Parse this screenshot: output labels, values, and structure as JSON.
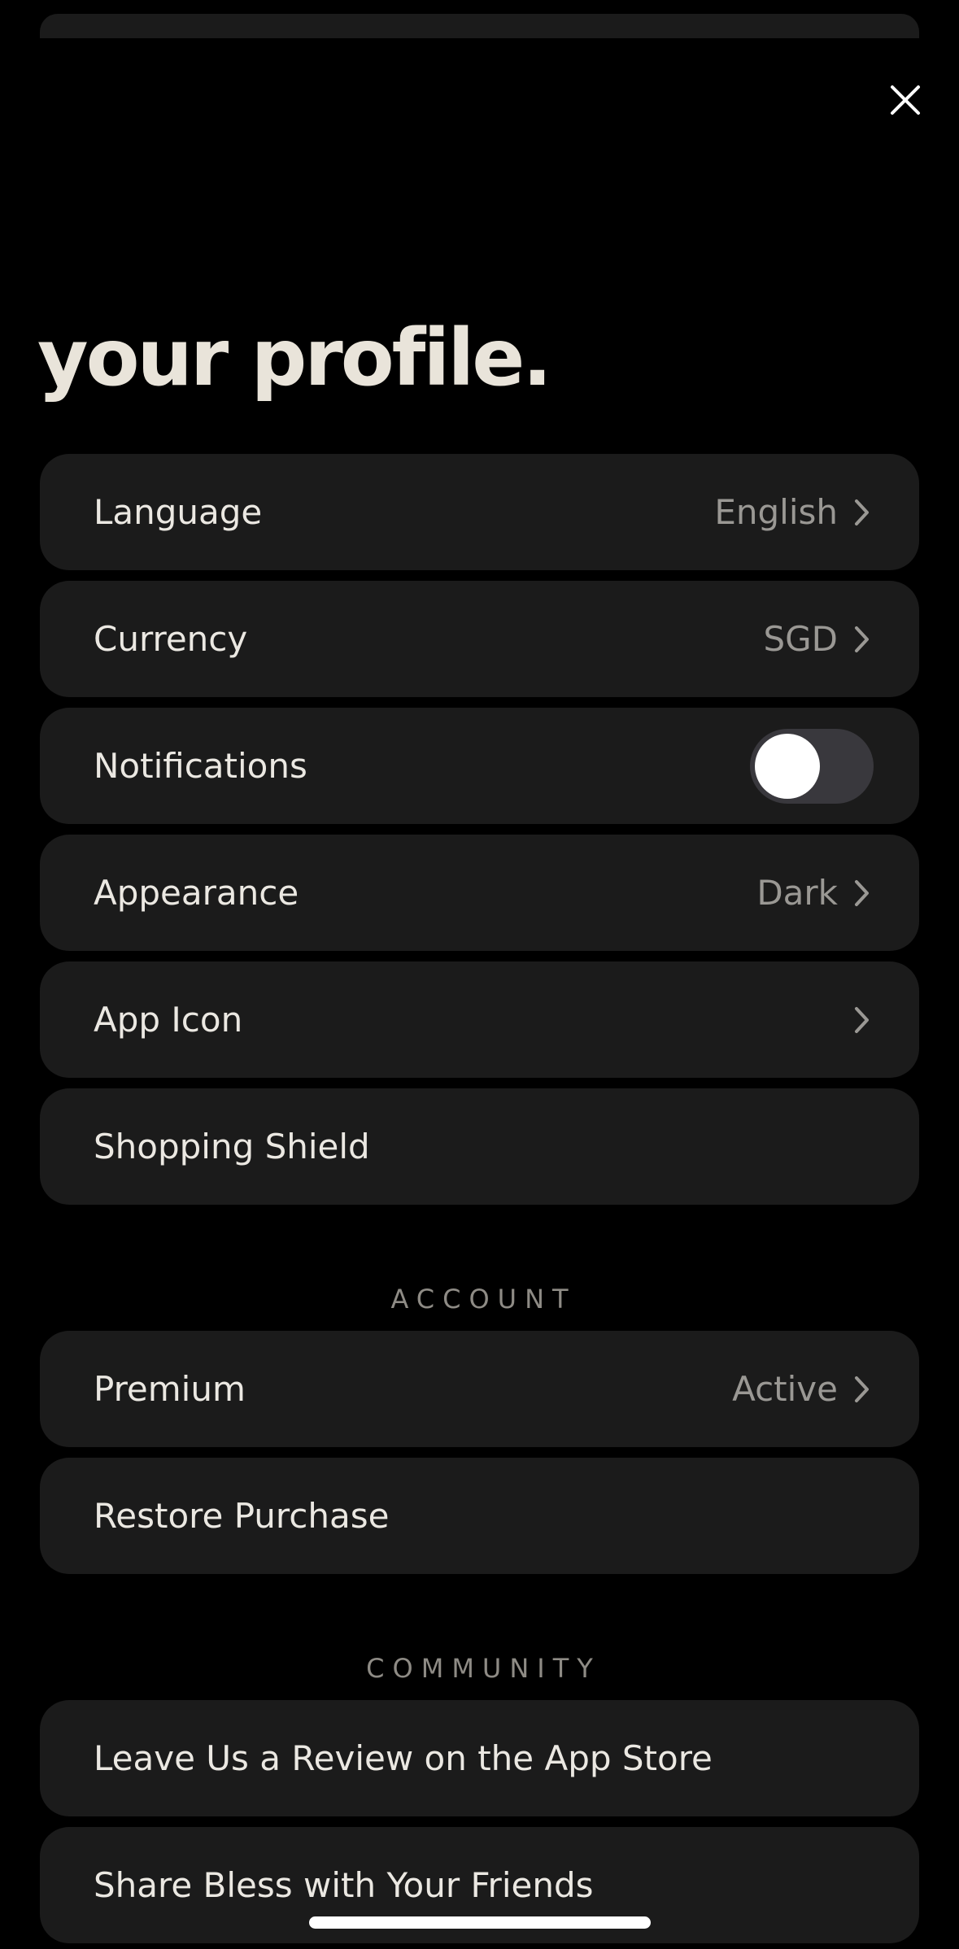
{
  "header": {
    "title": "your profile."
  },
  "settings": {
    "language": {
      "label": "Language",
      "value": "English"
    },
    "currency": {
      "label": "Currency",
      "value": "SGD"
    },
    "notifications": {
      "label": "Notifications",
      "enabled": true
    },
    "appearance": {
      "label": "Appearance",
      "value": "Dark"
    },
    "app_icon": {
      "label": "App Icon"
    },
    "shopping_shield": {
      "label": "Shopping Shield"
    }
  },
  "account": {
    "header": "ACCOUNT",
    "premium": {
      "label": "Premium",
      "value": "Active"
    },
    "restore": {
      "label": "Restore Purchase"
    }
  },
  "community": {
    "header": "COMMUNITY",
    "review": {
      "label": "Leave Us a Review on the App Store"
    },
    "share": {
      "label": "Share Bless with Your Friends"
    }
  },
  "icons": {
    "close": "close-icon",
    "chevron": "chevron-right-icon"
  },
  "colors": {
    "background": "#000000",
    "row_background": "#1b1b1b",
    "title": "#e9e4da",
    "label": "#ebe8e2",
    "value": "#9a9894",
    "toggle_track": "#39383d",
    "toggle_knob": "#ffffff"
  }
}
